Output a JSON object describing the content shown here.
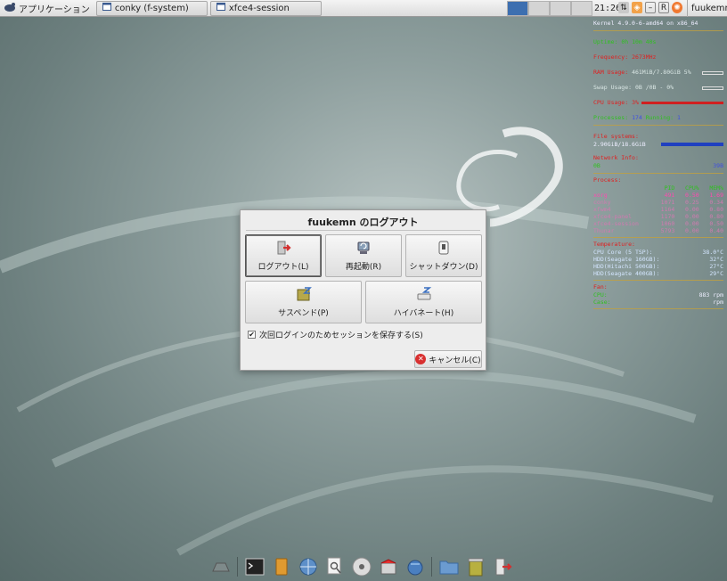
{
  "top_panel": {
    "app_menu_label": "アプリケーション",
    "tasks": [
      {
        "label": "conky (f-system)"
      },
      {
        "label": "xfce4-session"
      }
    ],
    "clock": "21:26",
    "user": "fuukemn"
  },
  "conky": {
    "kernel": "Kernel 4.9.0-6-amd64 on x86_64",
    "uptime_label": "Uptime:",
    "uptime": "0h 10m 40s",
    "frequency_label": "Frequency:",
    "frequency": "2673MHz",
    "ram_label": "RAM Usage:",
    "ram": "461MiB/7.80GiB",
    "ram_pct": "5%",
    "swap_label": "Swap Usage:",
    "swap": "0B /0B",
    "swap_pct": "- 0%",
    "cpu_label": "CPU Usage:",
    "cpu": "3%",
    "processes_label": "Processes:",
    "processes": "174",
    "running_label": "Running:",
    "running": "1",
    "filesystem_label": "File systems:",
    "filesystem": "2.90GiB/18.6GiB",
    "network_label": "Network Info:",
    "net_left": "0B",
    "net_right": "39B",
    "process_label": "Process:",
    "process_header": [
      "PID",
      "CPU%",
      "MEM%"
    ],
    "process_rows": [
      [
        "xorg",
        "491",
        "0.50",
        "1.69"
      ],
      [
        "conky",
        "1071",
        "0.25",
        "0.34"
      ],
      [
        "xfwm4",
        "1164",
        "0.00",
        "0.80"
      ],
      [
        "xfce4-panel",
        "1170",
        "0.00",
        "0.80"
      ],
      [
        "xfce4-session",
        "1060",
        "0.00",
        "0.50"
      ],
      [
        "Thunar",
        "5793",
        "0.00",
        "0.40"
      ]
    ],
    "temperature_label": "Temperature:",
    "temps": [
      [
        "CPU Core (5 TSP):",
        "38.0°C"
      ],
      [
        "HDD(Seagate 160GB):",
        "32°C"
      ],
      [
        "HDD(Hitachi 500GB):",
        "27°C"
      ],
      [
        "HDD(Seagate 400GB):",
        "29°C"
      ]
    ],
    "fan_label": "Fan:",
    "fans": [
      [
        "CPU:",
        "883 rpm"
      ],
      [
        "Case:",
        "rpm"
      ]
    ]
  },
  "dialog": {
    "title": "fuukemn のログアウト",
    "buttons": {
      "logout": "ログアウト(L)",
      "restart": "再起動(R)",
      "shutdown": "シャットダウン(D)",
      "suspend": "サスペンド(P)",
      "hibernate": "ハイバネート(H)"
    },
    "save_session_label": "次回ログインのためセッションを保存する(S)",
    "cancel": "キャンセル(C)"
  },
  "colors": {
    "accent": "#3d6fb0",
    "conky_red": "#e02020",
    "conky_green": "#30c020",
    "conky_blue": "#4050e0"
  }
}
